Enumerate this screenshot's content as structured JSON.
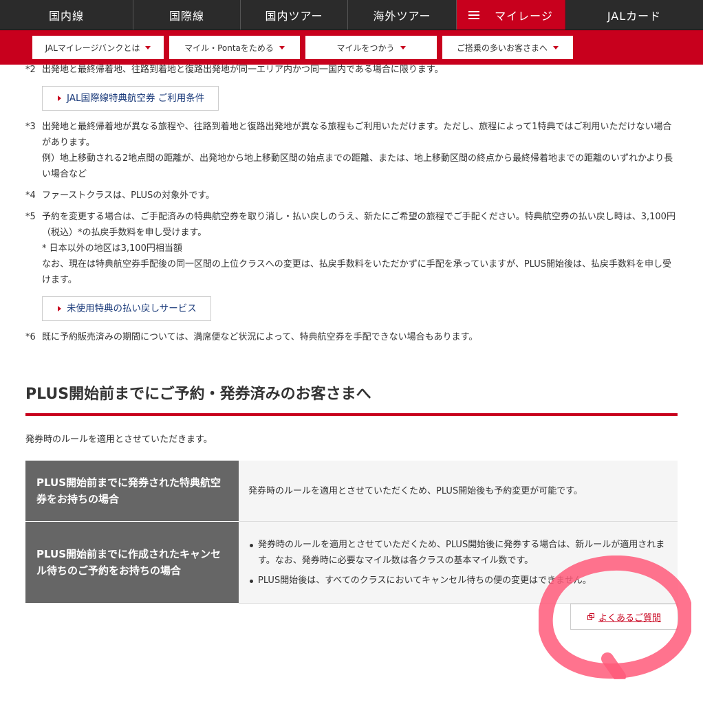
{
  "topnav": {
    "items": [
      {
        "label": "国内線"
      },
      {
        "label": "国際線"
      },
      {
        "label": "国内ツアー"
      },
      {
        "label": "海外ツアー"
      },
      {
        "label": "マイレージ",
        "active": true
      },
      {
        "label": "JALカード"
      }
    ]
  },
  "subnav": {
    "items": [
      {
        "label": "JALマイレージバンクとは"
      },
      {
        "label": "マイル・Pontaをためる"
      },
      {
        "label": "マイルをつかう"
      },
      {
        "label": "ご搭乗の多いお客さまへ"
      }
    ]
  },
  "notes": {
    "n2": {
      "num": "*2",
      "text": "出発地と最終帰着地、往路到着地と復路出発地が同一エリア内かつ同一国内である場合に限ります。"
    },
    "link1": "JAL国際線特典航空券 ご利用条件",
    "n3": {
      "num": "*3",
      "text": "出発地と最終帰着地が異なる旅程や、往路到着地と復路出発地が異なる旅程もご利用いただけます。ただし、旅程によって1特典ではご利用いただけない場合があります。",
      "example": "例）地上移動される2地点間の距離が、出発地から地上移動区間の始点までの距離、または、地上移動区間の終点から最終帰着地までの距離のいずれかより長い場合など"
    },
    "n4": {
      "num": "*4",
      "text": "ファーストクラスは、PLUSの対象外です。"
    },
    "n5": {
      "num": "*5",
      "text": "予約を変更する場合は、ご手配済みの特典航空券を取り消し・払い戻しのうえ、新たにご希望の旅程でご手配ください。特典航空券の払い戻し時は、3,100円（税込）*の払戻手数料を申し受けます。",
      "sub": "* 日本以外の地区は3,100円相当額",
      "extra": "なお、現在は特典航空券手配後の同一区間の上位クラスへの変更は、払戻手数料をいただかずに手配を承っていますが、PLUS開始後は、払戻手数料を申し受けます。"
    },
    "link2": "未使用特典の払い戻しサービス",
    "n6": {
      "num": "*6",
      "text": "既に予約販売済みの期間については、満席便など状況によって、特典航空券を手配できない場合もあります。"
    }
  },
  "section": {
    "title": "PLUS開始前までにご予約・発券済みのお客さまへ",
    "intro": "発券時のルールを適用とさせていただきます。"
  },
  "table": {
    "rows": [
      {
        "header": "PLUS開始前までに発券された特典航空券をお持ちの場合",
        "body": "発券時のルールを適用とさせていただくため、PLUS開始後も予約変更が可能です。"
      },
      {
        "header": "PLUS開始前までに作成されたキャンセル待ちのご予約をお持ちの場合",
        "bullets": [
          "発券時のルールを適用とさせていただくため、PLUS開始後に発券する場合は、新ルールが適用されます。なお、発券時に必要なマイル数は各クラスの基本マイル数です。",
          "PLUS開始後は、すべてのクラスにおいてキャンセル待ちの便の変更はできません。"
        ]
      }
    ]
  },
  "faq": {
    "label": "よくあるご質問",
    "icon": "external-window-icon"
  },
  "colors": {
    "brand_red": "#c8001d",
    "nav_dark": "#2b2b2b",
    "table_header": "#666666",
    "annotation": "#ff5a7a"
  }
}
